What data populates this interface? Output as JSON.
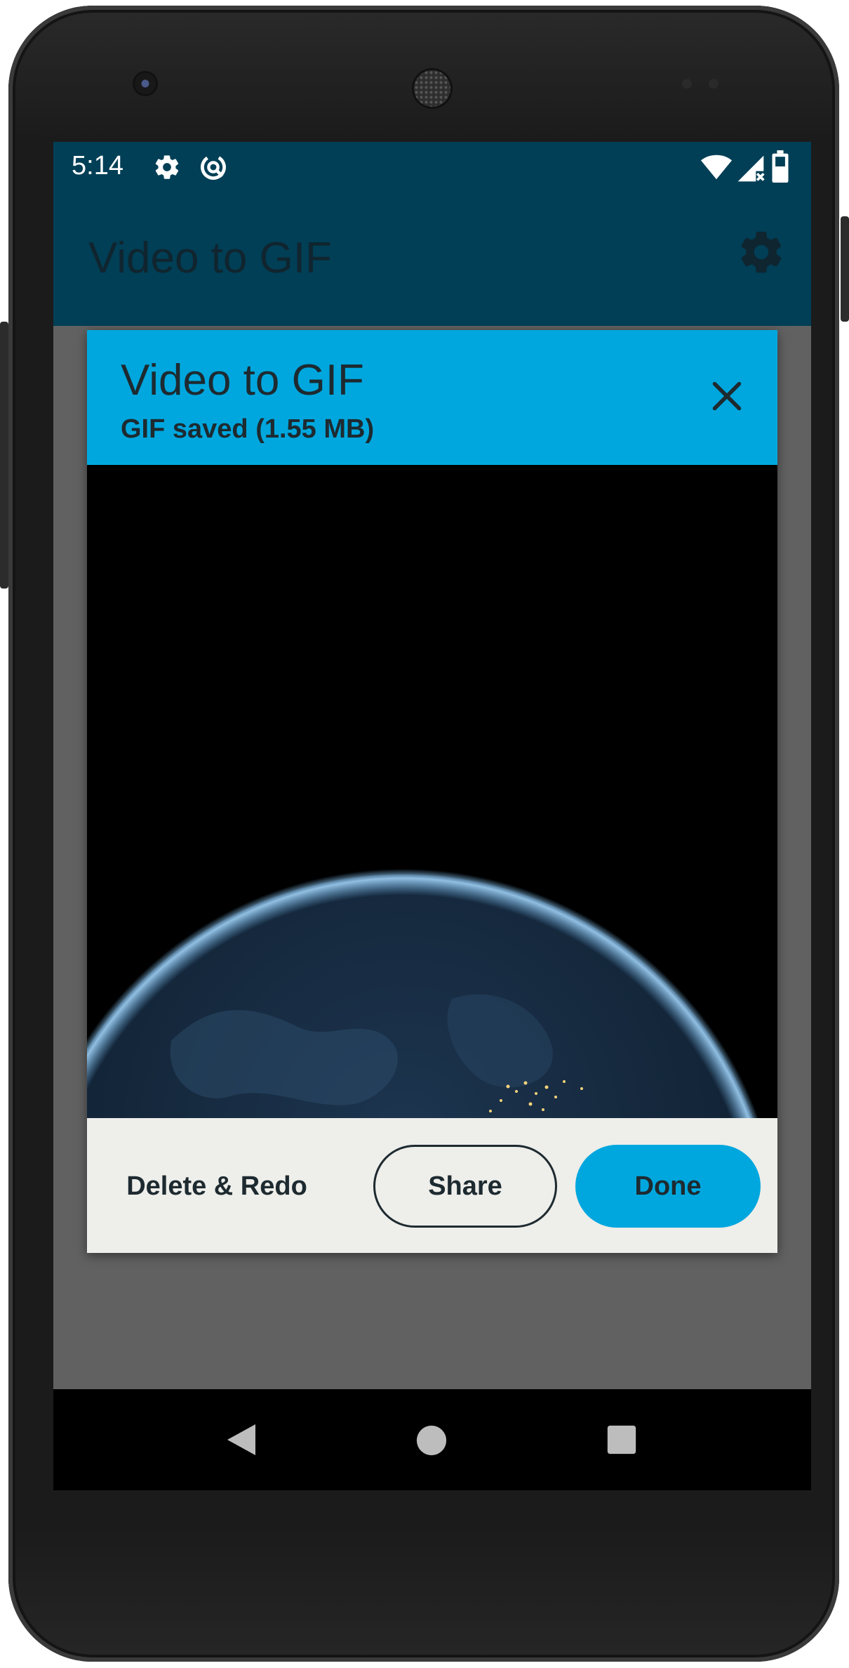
{
  "status_bar": {
    "time": "5:14",
    "left_icons": [
      "gear-icon",
      "data-saver-icon"
    ],
    "right_icons": [
      "wifi-icon",
      "cell-signal-no-service-icon",
      "battery-icon"
    ]
  },
  "app_bar": {
    "title": "Video to GIF",
    "settings_icon": "gear-icon"
  },
  "dialog": {
    "title": "Video to GIF",
    "subtitle": "GIF saved (1.55 MB)",
    "close_icon": "close-icon",
    "buttons": {
      "delete_redo": "Delete & Redo",
      "share": "Share",
      "done": "Done"
    }
  },
  "nav_bar": {
    "icons": [
      "back-icon",
      "home-icon",
      "recents-icon"
    ]
  },
  "colors": {
    "app_bar": "#003f56",
    "dialog_header": "#00a7de",
    "accent_button": "#00a7de",
    "scrim": "#616161"
  }
}
